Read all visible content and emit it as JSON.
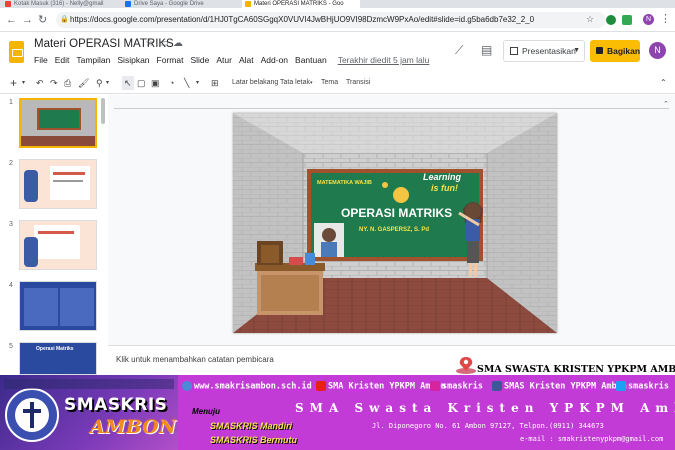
{
  "browser": {
    "tabs": [
      {
        "label": "Kotak Masuk (316) - Nelly@gmail",
        "active": false
      },
      {
        "label": "Drive Saya - Google Drive",
        "active": false
      },
      {
        "label": "Materi OPERASI MATRIKS - Goo",
        "active": true
      }
    ],
    "url": "https://docs.google.com/presentation/d/1HJ0TgCA60SGgqX0VUVI4JwBHjUO9VI98DzmcW9PxAo/edit#slide=id.g5ba6db7e32_2_0",
    "avatar_letter": "N"
  },
  "app": {
    "title": "Materi OPERASI MATRIKS",
    "menu": [
      "File",
      "Edit",
      "Tampilan",
      "Sisipkan",
      "Format",
      "Slide",
      "Atur",
      "Alat",
      "Add-on",
      "Bantuan"
    ],
    "last_edit": "Terakhir diedit 5 jam lalu",
    "present_label": "Presentasikan",
    "share_label": "Bagikan",
    "avatar_letter": "N"
  },
  "toolbar": {
    "background": "Latar belakang",
    "layout": "Tata letak",
    "theme": "Tema",
    "transition": "Transisi"
  },
  "filmstrip": {
    "numbers": [
      "1",
      "2",
      "3",
      "4",
      "5"
    ],
    "thumb5_title": "Operasi Matriks"
  },
  "slide": {
    "board_small": "MATEMATIKA WAJIB",
    "board_title": "OPERASI MATRIKS",
    "board_author": "NY. N. GASPERSZ, S. Pd",
    "learning1": "Learning",
    "learning2": "is fun!"
  },
  "notes_placeholder": "Klik untuk menambahkan catatan pembicara",
  "school_location": "SMA SWASTA KRISTEN YPKPM AMBON",
  "banner": {
    "brand1": "SMASKRIS",
    "brand2": "AMBON",
    "website": "www.smakrisambon.sch.id",
    "youtube": "SMA Kristen YPKPM Ambon",
    "instagram": "smaskris",
    "facebook": "SMAS Kristen YPKPM Ambon",
    "twitter": "smaskris",
    "motto_label": "Menuju",
    "motto1": "SMASKRIS Mandiri",
    "motto2": "SMASKRIS Bermutu",
    "school_name": "SMA Swasta Kristen YPKPM Ambon",
    "address": "Jl. Diponegoro  No. 61 Ambon 97127, Telpon.(0911) 344673",
    "email": "e-mail : smakristenypkpm@gmail.com"
  },
  "colors": {
    "accent": "#f4b400",
    "banner": "#c23bd6",
    "board": "#1f7a4d"
  }
}
